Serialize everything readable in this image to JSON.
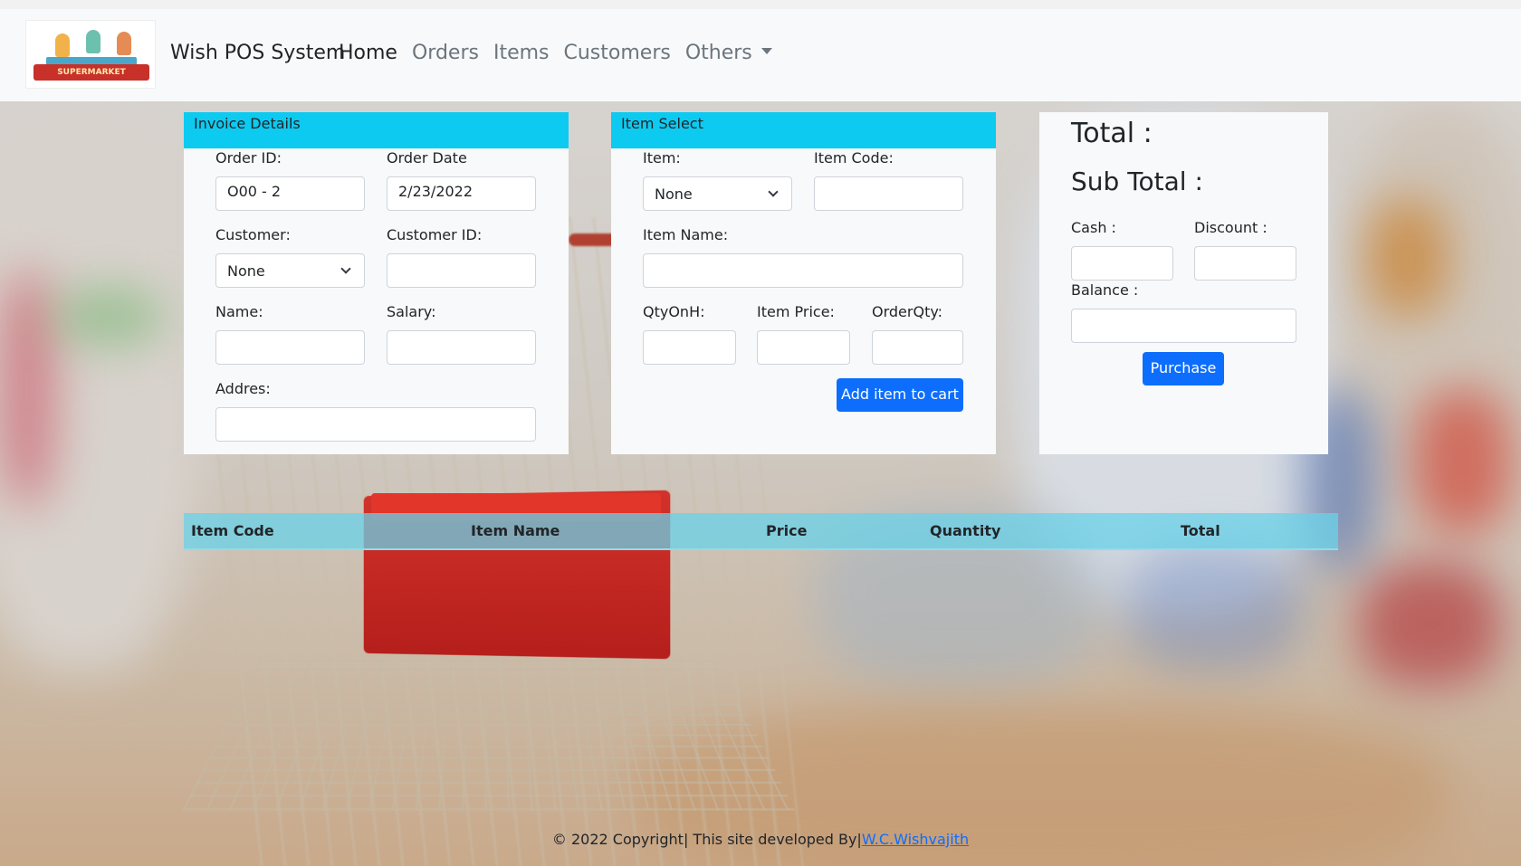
{
  "navbar": {
    "logo_text": "SUPERMARKET",
    "brand": "Wish POS System",
    "links": [
      {
        "label": "Home"
      },
      {
        "label": "Orders"
      },
      {
        "label": "Items"
      },
      {
        "label": "Customers"
      },
      {
        "label": "Others"
      }
    ]
  },
  "invoice": {
    "header": "Invoice Details",
    "order_id_label": "Order ID:",
    "order_id_value": "O00 - 2",
    "order_date_label": "Order Date",
    "order_date_value": "2/23/2022",
    "customer_label": "Customer:",
    "customer_value": "None",
    "customer_id_label": "Customer ID:",
    "customer_id_value": "",
    "name_label": "Name:",
    "name_value": "",
    "salary_label": "Salary:",
    "salary_value": "",
    "address_label": "Addres:",
    "address_value": ""
  },
  "item_select": {
    "header": "Item Select",
    "item_label": "Item:",
    "item_value": "None",
    "item_code_label": "Item Code:",
    "item_code_value": "",
    "item_name_label": "Item Name:",
    "item_name_value": "",
    "qty_on_hand_label": "QtyOnH:",
    "item_price_label": "Item Price:",
    "order_qty_label": "OrderQty:",
    "add_button": "Add item to cart"
  },
  "summary": {
    "total_label": "Total :",
    "sub_total_label": "Sub Total :",
    "cash_label": "Cash :",
    "discount_label": "Discount :",
    "balance_label": "Balance :",
    "purchase_button": "Purchase"
  },
  "table": {
    "columns": [
      "Item Code",
      "Item Name",
      "Price",
      "Quantity",
      "Total"
    ],
    "rows": []
  },
  "footer": {
    "text": "© 2022 Copyright| This site developed By|",
    "link": "W.C.Wishvajith"
  },
  "colors": {
    "panel_header": "#0dcaf0",
    "primary_button": "#0d6efd",
    "table_header": "#6ad2e8",
    "navbar": "#f8f9fa"
  }
}
